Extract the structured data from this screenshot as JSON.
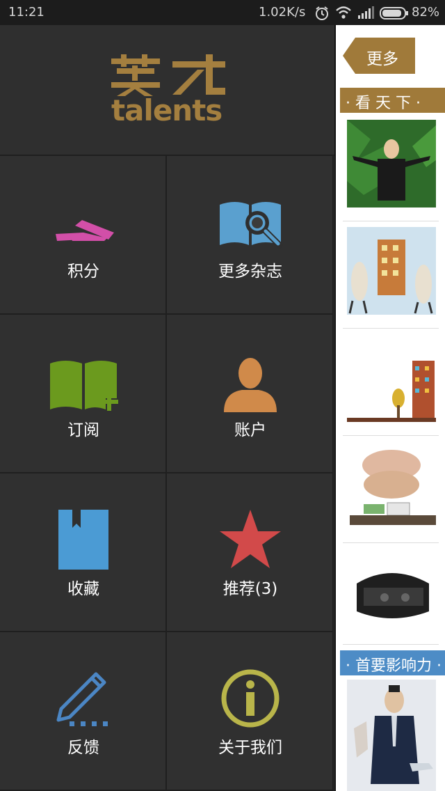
{
  "status_bar": {
    "time": "11:21",
    "speed": "1.02K/s",
    "battery": "82%",
    "icons": [
      "alarm-icon",
      "wifi-icon",
      "signal-icon",
      "battery-icon"
    ]
  },
  "logo": {
    "chinese": "英才",
    "english": "talents",
    "color": "#a47f3f"
  },
  "menu": {
    "items": [
      {
        "label": "积分",
        "icon": "points-icon",
        "color": "#d24fa8"
      },
      {
        "label": "更多杂志",
        "icon": "magazine-search-icon",
        "color": "#5aa0cf"
      },
      {
        "label": "订阅",
        "icon": "subscribe-book-icon",
        "color": "#6b9a1e"
      },
      {
        "label": "账户",
        "icon": "account-person-icon",
        "color": "#d08a4a"
      },
      {
        "label": "收藏",
        "icon": "bookmark-icon",
        "color": "#4b9bd4"
      },
      {
        "label": "推荐(3)",
        "icon": "star-icon",
        "color": "#d24a4a"
      },
      {
        "label": "反馈",
        "icon": "pencil-feedback-icon",
        "color": "#4b86c4"
      },
      {
        "label": "关于我们",
        "icon": "info-icon",
        "color": "#b9b54a"
      }
    ]
  },
  "panel": {
    "more_label": "更多",
    "section_1": "· 看 天 下 ·",
    "section_2": "· 首要影响力 ·",
    "accent_gold": "#a07a3a",
    "accent_blue": "#4d8cc6"
  }
}
